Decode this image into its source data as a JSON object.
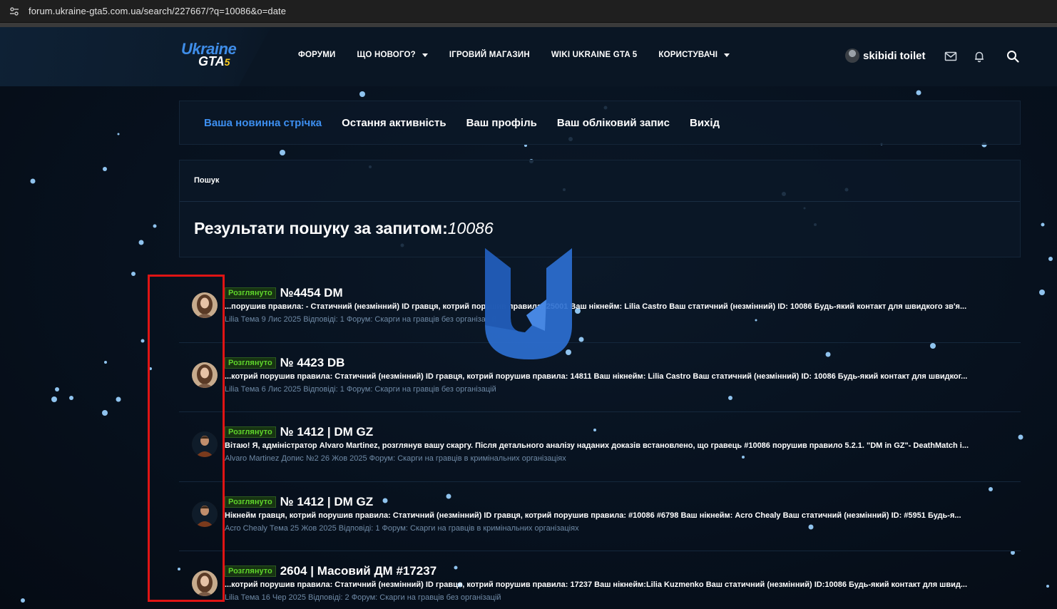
{
  "browser": {
    "url": "forum.ukraine-gta5.com.ua/search/227667/?q=10086&o=date",
    "site_icon": "tune-icon"
  },
  "logo": {
    "line1": "Ukraine",
    "line2": "GTA",
    "line2_suffix": "5"
  },
  "main_menu": [
    {
      "label": "ФОРУМИ",
      "dropdown": false
    },
    {
      "label": "ЩО НОВОГО?",
      "dropdown": true
    },
    {
      "label": "ІГРОВИЙ МАГАЗИН",
      "dropdown": false
    },
    {
      "label": "WIKI UKRAINE GTA 5",
      "dropdown": false
    },
    {
      "label": "КОРИСТУВАЧІ",
      "dropdown": true
    }
  ],
  "user": {
    "name": "skibidi toilet"
  },
  "header_icons": [
    "mail-icon",
    "bell-icon",
    "search-icon"
  ],
  "sub_nav": [
    {
      "label": "Ваша новинна стрічка",
      "active": true
    },
    {
      "label": "Остання активність",
      "active": false
    },
    {
      "label": "Ваш профіль",
      "active": false
    },
    {
      "label": "Ваш обліковий запис",
      "active": false
    },
    {
      "label": "Вихід",
      "active": false
    }
  ],
  "breadcrumb": "Пошук",
  "page_title": {
    "prefix": "Результати пошуку за запитом:",
    "query": "10086"
  },
  "results": [
    {
      "badge": "Розглянуто",
      "title": "№4454 DM",
      "snippet_before": "...порушив правила: - Статичний (незмінний) ID гравця, котрий порушив правила: 25001 Ваш нікнейм: Lilia Castro Ваш статичний (незмінний) ID: ",
      "snippet_bold": "10086",
      "snippet_after": " Будь-який контакт для швидкого зв'я...",
      "meta": "Lilia Тема 9 Лис 2025 Відповіді: 1 Форум: Скарги на гравців без організацій",
      "avatar": "female"
    },
    {
      "badge": "Розглянуто",
      "title": "№ 4423 DB",
      "snippet_before": "...котрий порушив правила: Статичний (незмінний) ID гравця, котрий порушив правила: 14811 Ваш нікнейм: Lilia Castro Ваш статичний (незмінний) ID: ",
      "snippet_bold": "10086",
      "snippet_after": " Будь-який контакт для швидког...",
      "meta": "Lilia Тема 6 Лис 2025 Відповіді: 1 Форум: Скарги на гравців без організацій",
      "avatar": "female"
    },
    {
      "badge": "Розглянуто",
      "title": "№ 1412 | DM GZ",
      "snippet_before": "Вітаю! Я, адміністратор Alvaro Martinez, розглянув вашу скаргу. Після детального аналізу наданих доказів встановлено, що гравець #",
      "snippet_bold": "10086",
      "snippet_after": " порушив правило 5.2.1. \"DM in GZ\"- DeathMatch i...",
      "meta": "Alvaro Martinez Допис №2 26 Жов 2025 Форум: Скарги на гравців в кримінальних організаціях",
      "avatar": "male"
    },
    {
      "badge": "Розглянуто",
      "title": "№ 1412 | DM GZ",
      "snippet_before": "Нікнейм гравця, котрий порушив правила: Статичний (незмінний) ID гравця, котрий порушив правила: #",
      "snippet_bold": "10086",
      "snippet_after": " #6798 Ваш нікнейм: Acro Chealy Ваш статичний (незмінний) ID: #5951 Будь-я...",
      "meta": "Acro Chealy Тема 25 Жов 2025 Відповіді: 1 Форум: Скарги на гравців в кримінальних організаціях",
      "avatar": "male"
    },
    {
      "badge": "Розглянуто",
      "title": "2604 | Масовий ДМ #17237",
      "snippet_before": "...котрий порушив правила: Статичний (незмінний) ID гравця, котрий порушив правила: 17237 Ваш нікнейм:Lilia Kuzmenko Ваш статичний (незмінний) ID:",
      "snippet_bold": "10086",
      "snippet_after": " Будь-який контакт для швид...",
      "meta": "Lilia Тема 16 Чер 2025 Відповіді: 2 Форум: Скарги на гравців без організацій",
      "avatar": "female"
    }
  ],
  "colors": {
    "accent": "#3d8ff0",
    "badge_green": "#5fd52b",
    "highlight_red": "#e01414",
    "meta_text": "#6f8aa6"
  }
}
